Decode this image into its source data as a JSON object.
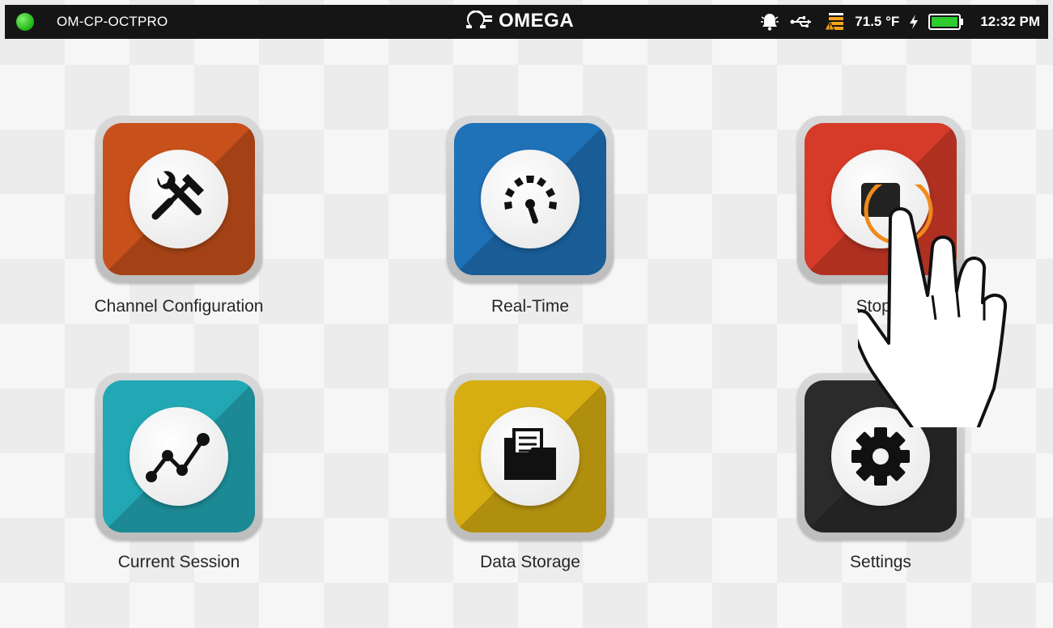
{
  "status_bar": {
    "device_name": "OM-CP-OCTPRO",
    "logo_text": "OMEGA",
    "temperature": "71.5 °F",
    "time": "12:32 PM",
    "status_color": "#22b618",
    "icons": [
      "status-dot-icon",
      "omega-logo-icon",
      "alarm-bell-icon",
      "usb-icon",
      "storage-warning-icon",
      "charging-icon",
      "battery-icon"
    ]
  },
  "tiles": [
    {
      "label": "Channel Configuration",
      "color": "#c8511b",
      "icon": "tools-icon"
    },
    {
      "label": "Real-Time",
      "color": "#1f71b8",
      "icon": "gauge-icon"
    },
    {
      "label": "Stop L",
      "color": "#d63a28",
      "icon": "stop-icon"
    },
    {
      "label": "Current Session",
      "color": "#22a8b5",
      "icon": "chart-line-icon"
    },
    {
      "label": "Data Storage",
      "color": "#d7ae12",
      "icon": "folder-icon"
    },
    {
      "label": "Settings",
      "color": "#2b2b2b",
      "icon": "gear-icon"
    }
  ],
  "overlay": {
    "icon": "hand-pointer-icon",
    "ring_color": "#f08a1c"
  }
}
